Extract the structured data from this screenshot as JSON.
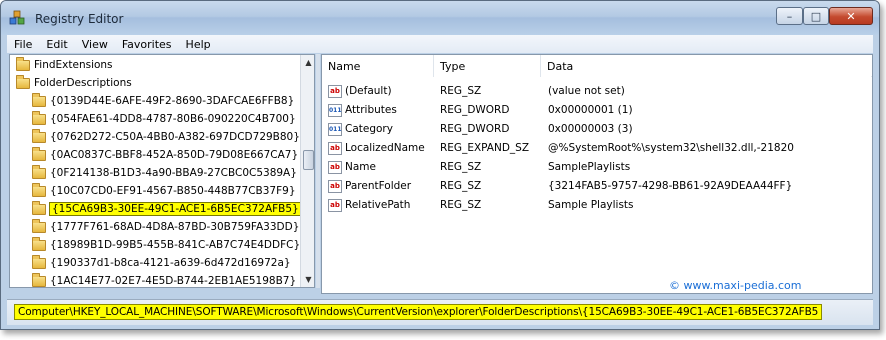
{
  "window": {
    "title": "Registry Editor",
    "controls": {
      "minimize": "–",
      "maximize": "□",
      "close": "✕"
    }
  },
  "menu": [
    "File",
    "Edit",
    "View",
    "Favorites",
    "Help"
  ],
  "tree": {
    "items": [
      {
        "label": "FindExtensions",
        "level": 0,
        "selected": false
      },
      {
        "label": "FolderDescriptions",
        "level": 0,
        "selected": false
      },
      {
        "label": "{0139D44E-6AFE-49F2-8690-3DAFCAE6FFB8}",
        "level": 1,
        "selected": false
      },
      {
        "label": "{054FAE61-4DD8-4787-80B6-090220C4B700}",
        "level": 1,
        "selected": false
      },
      {
        "label": "{0762D272-C50A-4BB0-A382-697DCD729B80}",
        "level": 1,
        "selected": false
      },
      {
        "label": "{0AC0837C-BBF8-452A-850D-79D08E667CA7}",
        "level": 1,
        "selected": false
      },
      {
        "label": "{0F214138-B1D3-4a90-BBA9-27CBC0C5389A}",
        "level": 1,
        "selected": false
      },
      {
        "label": "{10C07CD0-EF91-4567-B850-448B77CB37F9}",
        "level": 1,
        "selected": false
      },
      {
        "label": "{15CA69B3-30EE-49C1-ACE1-6B5EC372AFB5}",
        "level": 1,
        "selected": true
      },
      {
        "label": "{1777F761-68AD-4D8A-87BD-30B759FA33DD}",
        "level": 1,
        "selected": false
      },
      {
        "label": "{18989B1D-99B5-455B-841C-AB7C74E4DDFC}",
        "level": 1,
        "selected": false
      },
      {
        "label": "{190337d1-b8ca-4121-a639-6d472d16972a}",
        "level": 1,
        "selected": false
      },
      {
        "label": "{1AC14E77-02E7-4E5D-B744-2EB1AE5198B7}",
        "level": 1,
        "selected": false
      }
    ]
  },
  "list": {
    "columns": {
      "name": "Name",
      "type": "Type",
      "data": "Data"
    },
    "rows": [
      {
        "icon": "string-value-icon",
        "badge": "ab",
        "name": "(Default)",
        "type": "REG_SZ",
        "data": "(value not set)"
      },
      {
        "icon": "binary-value-icon",
        "badge": "011",
        "name": "Attributes",
        "type": "REG_DWORD",
        "data": "0x00000001 (1)"
      },
      {
        "icon": "binary-value-icon",
        "badge": "011",
        "name": "Category",
        "type": "REG_DWORD",
        "data": "0x00000003 (3)"
      },
      {
        "icon": "string-value-icon",
        "badge": "ab",
        "name": "LocalizedName",
        "type": "REG_EXPAND_SZ",
        "data": "@%SystemRoot%\\system32\\shell32.dll,-21820"
      },
      {
        "icon": "string-value-icon",
        "badge": "ab",
        "name": "Name",
        "type": "REG_SZ",
        "data": "SamplePlaylists"
      },
      {
        "icon": "string-value-icon",
        "badge": "ab",
        "name": "ParentFolder",
        "type": "REG_SZ",
        "data": "{3214FAB5-9757-4298-BB61-92A9DEAA44FF}"
      },
      {
        "icon": "string-value-icon",
        "badge": "ab",
        "name": "RelativePath",
        "type": "REG_SZ",
        "data": "Sample Playlists"
      }
    ]
  },
  "watermark": "© www.maxi-pedia.com",
  "status": {
    "path": "Computer\\HKEY_LOCAL_MACHINE\\SOFTWARE\\Microsoft\\Windows\\CurrentVersion\\explorer\\FolderDescriptions\\{15CA69B3-30EE-49C1-ACE1-6B5EC372AFB5"
  },
  "colors": {
    "highlight": "#ffff00",
    "watermark": "#1a6ed6",
    "chrome": "#bcd0e6"
  }
}
